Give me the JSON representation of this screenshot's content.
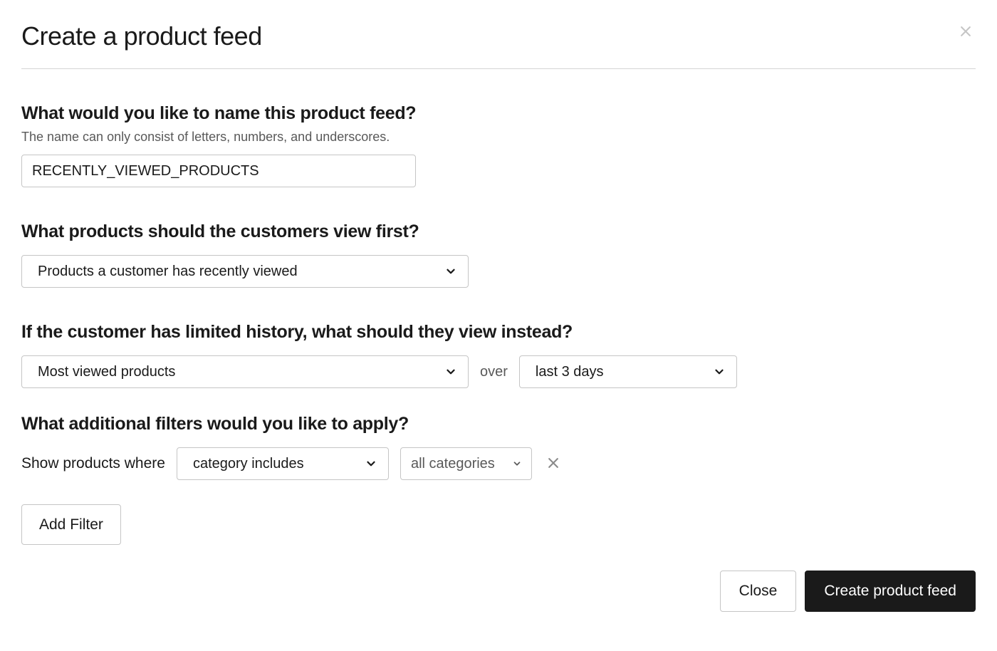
{
  "modal": {
    "title": "Create a product feed"
  },
  "name_section": {
    "title": "What would you like to name this product feed?",
    "subtitle": "The name can only consist of letters, numbers, and underscores.",
    "value": "RECENTLY_VIEWED_PRODUCTS"
  },
  "view_first_section": {
    "title": "What products should the customers view first?",
    "selected": "Products a customer has recently viewed"
  },
  "fallback_section": {
    "title": "If the customer has limited history, what should they view instead?",
    "product_selected": "Most viewed products",
    "over_label": "over",
    "time_selected": "last 3 days"
  },
  "filters_section": {
    "title": "What additional filters would you like to apply?",
    "show_label": "Show products where",
    "filter_type_selected": "category includes",
    "filter_value_selected": "all categories",
    "add_filter_label": "Add Filter"
  },
  "footer": {
    "close_label": "Close",
    "submit_label": "Create product feed"
  }
}
